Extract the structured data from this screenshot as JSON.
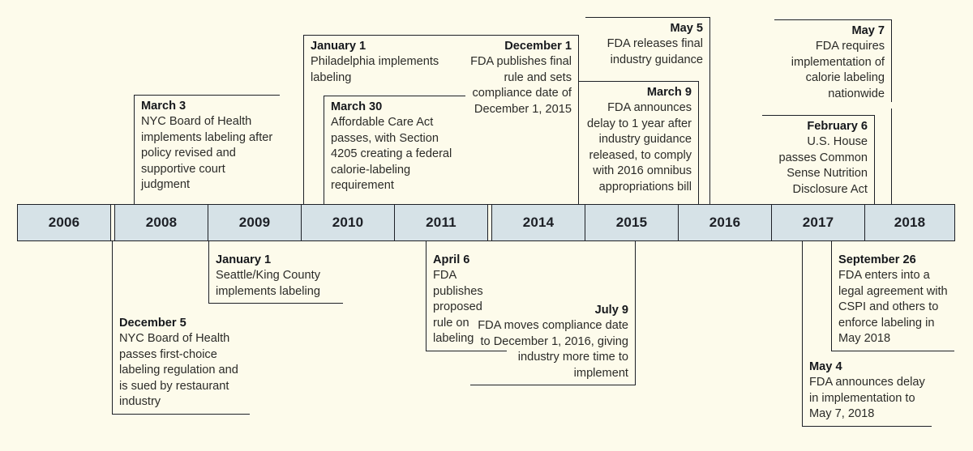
{
  "figure": {
    "name": "calorie-labeling-policy-timeline",
    "background_color": "#fdfbeb",
    "bar_color": "#d6e2e7",
    "line_color": "#1d2026"
  },
  "axis": {
    "years": [
      {
        "label": "2006"
      },
      {
        "label": "2008"
      },
      {
        "label": "2009"
      },
      {
        "label": "2010"
      },
      {
        "label": "2011"
      },
      {
        "label": "2014"
      },
      {
        "label": "2015"
      },
      {
        "label": "2016"
      },
      {
        "label": "2017"
      },
      {
        "label": "2018"
      }
    ]
  },
  "events_above": [
    {
      "date": "March 3",
      "text": "NYC Board of Health implements labeling after policy revised and supportive court judgment",
      "year": "2008",
      "align": "left"
    },
    {
      "date": "January 1",
      "text": "Philadelphia implements labeling",
      "year": "2010",
      "align": "left"
    },
    {
      "date": "March 30",
      "text": "Affordable Care Act passes, with Section 4205 creating a federal calorie-labeling requirement",
      "year": "2010",
      "align": "left"
    },
    {
      "date": "December 1",
      "text": "FDA publishes final rule and sets compliance date of December 1, 2015",
      "year": "2014",
      "align": "right"
    },
    {
      "date": "May 5",
      "text": "FDA releases final industry guidance",
      "year": "2016",
      "align": "right"
    },
    {
      "date": "March 9",
      "text": "FDA announces delay to 1 year after industry guidance released, to comply with 2016 omnibus appropriations bill",
      "year": "2016",
      "align": "right"
    },
    {
      "date": "May 7",
      "text": "FDA requires implementation of calorie labeling nationwide",
      "year": "2018",
      "align": "right"
    },
    {
      "date": "February 6",
      "text": "U.S. House passes Common Sense Nutrition Disclosure Act",
      "year": "2018",
      "align": "right"
    }
  ],
  "events_below": [
    {
      "date": "December 5",
      "text": "NYC Board of Health passes first-choice labeling regulation and is sued by restaurant industry",
      "year": "2006",
      "align": "left"
    },
    {
      "date": "January 1",
      "text": "Seattle/King County implements labeling",
      "year": "2009",
      "align": "left"
    },
    {
      "date": "April 6",
      "text": "FDA publishes proposed rule on labeling",
      "year": "2011",
      "align": "left"
    },
    {
      "date": "July 9",
      "text": "FDA moves compliance date to December 1, 2016, giving industry more time to implement",
      "year": "2015",
      "align": "right"
    },
    {
      "date": "September 26",
      "text": "FDA enters into a legal agreement with CSPI and others to enforce labeling in May 2018",
      "year": "2017",
      "align": "left"
    },
    {
      "date": "May 4",
      "text": "FDA announces delay in implementation to May 7, 2018",
      "year": "2017",
      "align": "left"
    }
  ]
}
